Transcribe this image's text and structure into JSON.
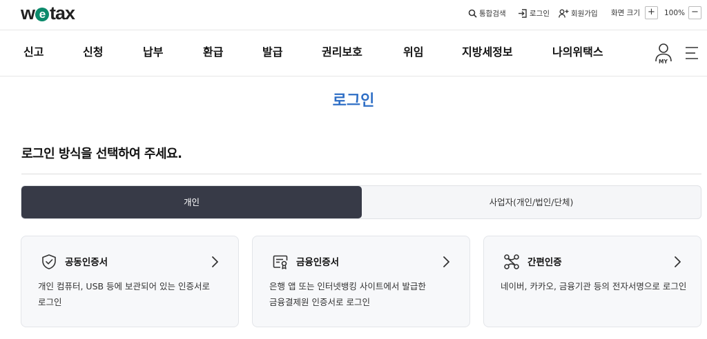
{
  "brand": {
    "logo_prefix": "w",
    "logo_e": "e",
    "logo_suffix": "tax"
  },
  "utility": {
    "search_label": "통합검색",
    "login_label": "로그인",
    "join_label": "회원가입",
    "font_size_label": "화면 크기",
    "zoom_in": "+",
    "zoom_value": "100%",
    "zoom_out": "−"
  },
  "nav": {
    "items": [
      "신고",
      "신청",
      "납부",
      "환급",
      "발급",
      "권리보호",
      "위임",
      "지방세정보",
      "나의위택스"
    ],
    "my_label": "MY"
  },
  "page": {
    "title": "로그인",
    "section_title": "로그인 방식을 선택하여 주세요."
  },
  "tabs": {
    "personal": "개인",
    "business": "사업자(개인/법인/단체)",
    "active": "personal"
  },
  "cards": [
    {
      "icon": "shield-icon",
      "title": "공동인증서",
      "desc": "개인 컴퓨터, USB 등에 보관되어 있는 인증서로 로그인"
    },
    {
      "icon": "certificate-icon",
      "title": "금융인증서",
      "desc": "은행 앱 또는 인터넷뱅킹 사이트에서 발급한 금융결제원 인증서로 로그인"
    },
    {
      "icon": "network-icon",
      "title": "간편인증",
      "desc": "네이버, 카카오, 금융기관 등의 전자서명으로 로그인"
    }
  ],
  "colors": {
    "accent_title": "#2f6fc6",
    "active_tab": "#373a47",
    "logo_e": "#0b8a6b"
  }
}
